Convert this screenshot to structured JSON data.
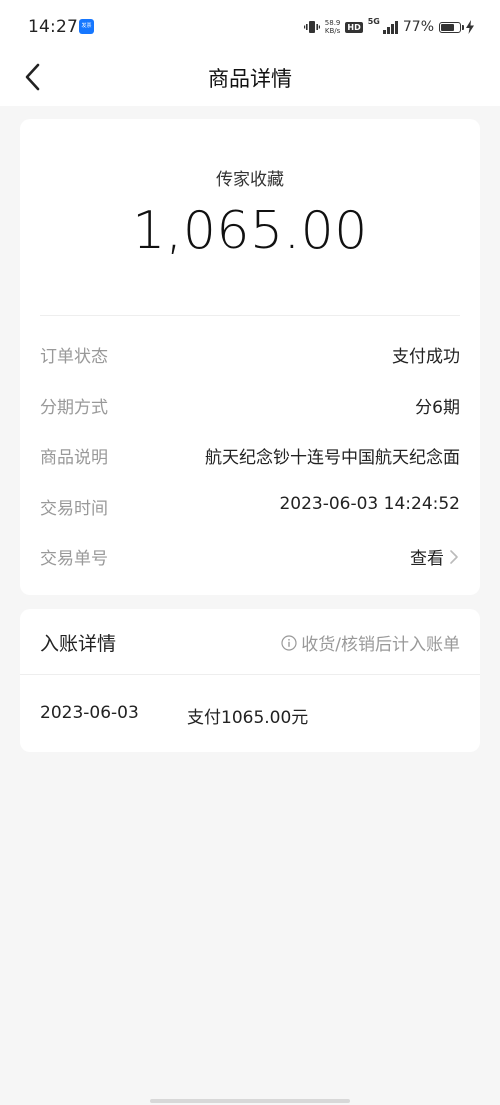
{
  "status_bar": {
    "time": "14:27",
    "app_badge": "发票",
    "speed_value": "58.9",
    "speed_unit": "KB/s",
    "hd": "HD",
    "network": "5G",
    "battery_percent": "77%",
    "battery_level": 0.77
  },
  "header": {
    "title": "商品详情",
    "back_icon": "chevron-left-icon"
  },
  "summary": {
    "product_name": "传家收藏",
    "amount": "1,065.00"
  },
  "details": [
    {
      "label": "订单状态",
      "value": "支付成功"
    },
    {
      "label": "分期方式",
      "value": "分6期"
    },
    {
      "label": "商品说明",
      "value": "航天纪念钞十连号中国航天纪念面"
    },
    {
      "label": "交易时间",
      "value": "2023-06-03 14:24:52"
    },
    {
      "label": "交易单号",
      "value": "查看"
    }
  ],
  "entry": {
    "title": "入账详情",
    "note": "收货/核销后计入账单",
    "note_icon": "info-icon",
    "rows": [
      {
        "date": "2023-06-03",
        "desc": "支付1065.00元"
      }
    ]
  },
  "colors": {
    "background": "#f6f6f6",
    "card": "#ffffff",
    "muted_text": "#999999",
    "primary_text": "#222222"
  }
}
